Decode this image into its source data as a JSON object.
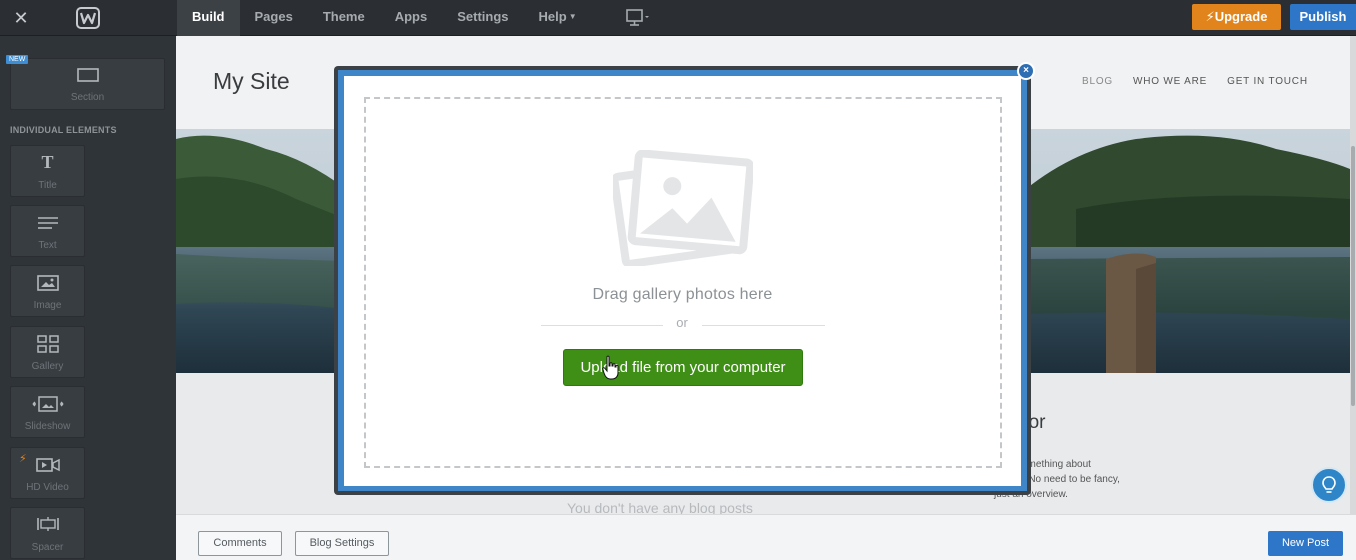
{
  "topbar": {
    "tabs": [
      {
        "label": "Build"
      },
      {
        "label": "Pages"
      },
      {
        "label": "Theme"
      },
      {
        "label": "Apps"
      },
      {
        "label": "Settings"
      },
      {
        "label": "Help"
      }
    ],
    "upgrade_label": "Upgrade",
    "publish_label": "Publish",
    "upgrade_color": "#e2841c",
    "publish_color": "#2e77c8"
  },
  "sidebar": {
    "section_badge": "NEW",
    "section_label": "Section",
    "elements_heading": "INDIVIDUAL ELEMENTS",
    "elements": [
      {
        "label": "Title",
        "icon": "title-icon"
      },
      {
        "label": "Text",
        "icon": "text-icon"
      },
      {
        "label": "Image",
        "icon": "image-icon"
      },
      {
        "label": "Gallery",
        "icon": "gallery-icon"
      },
      {
        "label": "Slideshow",
        "icon": "slideshow-icon"
      },
      {
        "label": "HD Video",
        "icon": "video-icon"
      },
      {
        "label": "Spacer",
        "icon": "spacer-icon"
      }
    ]
  },
  "site": {
    "title": "My Site",
    "nav": [
      "BLOG",
      "WHO WE ARE",
      "GET IN TOUCH"
    ],
    "author_title": "hor",
    "author_text_1": "omething about",
    "author_text_2": "f. No need to be fancy,",
    "author_text_3": "just an overview.",
    "no_posts": "You don't have any blog posts"
  },
  "bottom": {
    "comments_label": "Comments",
    "blog_settings_label": "Blog Settings",
    "new_post_label": "New Post"
  },
  "modal": {
    "drag_text": "Drag gallery photos here",
    "or_text": "or",
    "upload_label": "Upload file from your computer",
    "close_symbol": "×",
    "upload_color": "#3f8f16"
  }
}
